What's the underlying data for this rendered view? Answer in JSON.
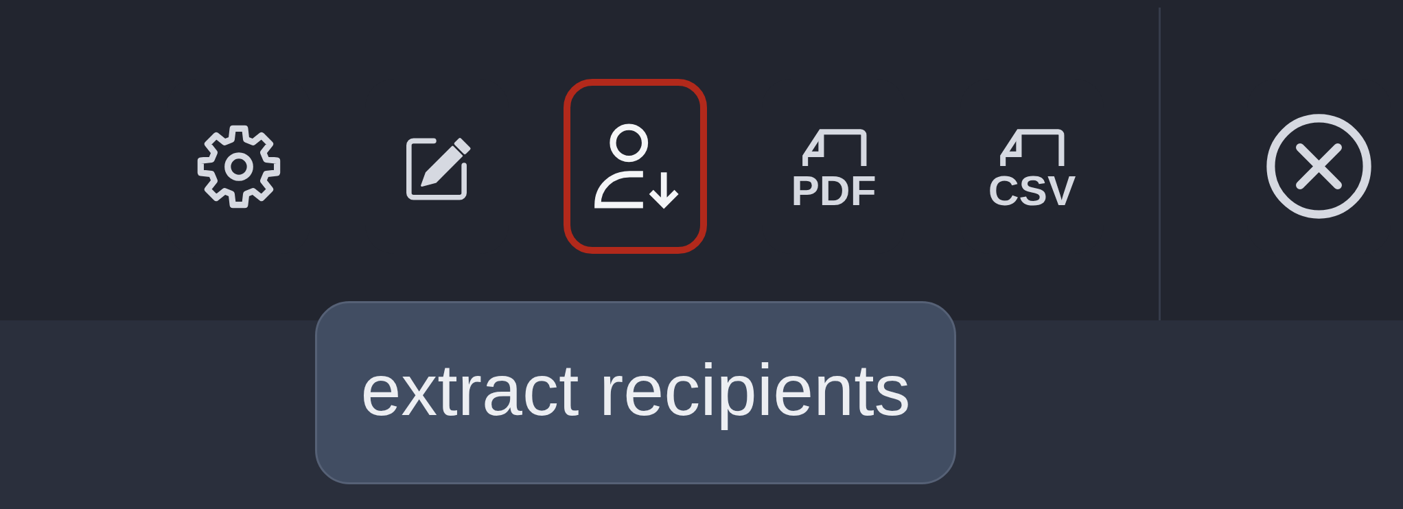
{
  "toolbar": {
    "buttons": [
      {
        "kind": "settings",
        "selected": false
      },
      {
        "kind": "edit",
        "selected": false
      },
      {
        "kind": "extract",
        "selected": true
      },
      {
        "kind": "file",
        "label": "PDF",
        "selected": false
      },
      {
        "kind": "file",
        "label": "CSV",
        "selected": false
      }
    ]
  },
  "tooltip": {
    "text": "extract recipients"
  }
}
